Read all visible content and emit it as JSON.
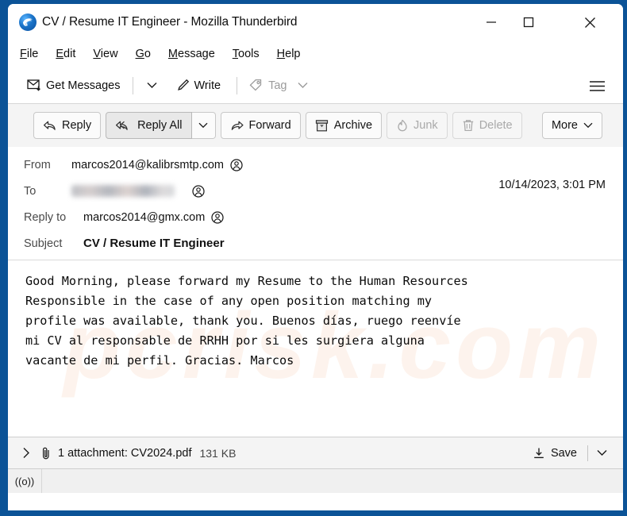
{
  "window": {
    "title": "CV / Resume IT Engineer - Mozilla Thunderbird",
    "app_icon": "thunderbird-icon",
    "controls": {
      "minimize": "minimize-icon",
      "maximize": "maximize-icon",
      "close": "close-icon"
    },
    "border_color": "#0b5397"
  },
  "menubar": {
    "items": [
      {
        "label": "File",
        "accesskey": "F"
      },
      {
        "label": "Edit",
        "accesskey": "E"
      },
      {
        "label": "View",
        "accesskey": "V"
      },
      {
        "label": "Go",
        "accesskey": "G"
      },
      {
        "label": "Message",
        "accesskey": "M"
      },
      {
        "label": "Tools",
        "accesskey": "T"
      },
      {
        "label": "Help",
        "accesskey": "H"
      }
    ]
  },
  "toolbar": {
    "get_messages_label": "Get Messages",
    "get_messages_icon": "inbox-download-icon",
    "get_messages_caret": "chevron-down-icon",
    "write_label": "Write",
    "write_icon": "pencil-icon",
    "tag_label": "Tag",
    "tag_icon": "tag-icon",
    "tag_caret": "chevron-down-icon",
    "tag_disabled": true,
    "app_menu_icon": "hamburger-menu-icon"
  },
  "message_actions": {
    "reply": {
      "label": "Reply",
      "icon": "reply-arrow-icon",
      "disabled": false
    },
    "reply_all": {
      "label": "Reply All",
      "icon": "reply-all-arrow-icon",
      "disabled": false
    },
    "reply_all_caret": "chevron-down-icon",
    "forward": {
      "label": "Forward",
      "icon": "forward-arrow-icon",
      "disabled": false
    },
    "archive": {
      "label": "Archive",
      "icon": "archive-box-icon",
      "disabled": false
    },
    "junk": {
      "label": "Junk",
      "icon": "flame-icon",
      "disabled": true
    },
    "delete": {
      "label": "Delete",
      "icon": "trash-icon",
      "disabled": true
    },
    "more": {
      "label": "More",
      "caret": "chevron-down-icon"
    }
  },
  "headers": {
    "from_label": "From",
    "from_value": "marcos2014@kalibrsmtp.com",
    "to_label": "To",
    "to_value": "",
    "to_redacted": true,
    "reply_to_label": "Reply to",
    "reply_to_value": "marcos2014@gmx.com",
    "subject_label": "Subject",
    "subject_value": "CV / Resume IT Engineer",
    "date": "10/14/2023, 3:01 PM",
    "contact_icon": "contact-avatar-icon"
  },
  "body": {
    "text": "Good Morning, please forward my Resume to the Human Resources\nResponsible in the case of any open position matching my\nprofile was available, thank you. Buenos días, ruego reenvíe\nmi CV al responsable de RRHH por si les surgiera alguna\nvacante de mi perfil. Gracias. Marcos",
    "watermark": "pcrisk.com"
  },
  "attachment": {
    "expand_icon": "chevron-right-icon",
    "clip_icon": "paperclip-icon",
    "summary": "1 attachment: CV2024.pdf",
    "size": "131 KB",
    "save_label": "Save",
    "save_icon": "download-icon",
    "save_caret": "chevron-down-icon"
  },
  "statusbar": {
    "connection_icon": "online-signal-icon",
    "connection_glyph": "((o))"
  }
}
